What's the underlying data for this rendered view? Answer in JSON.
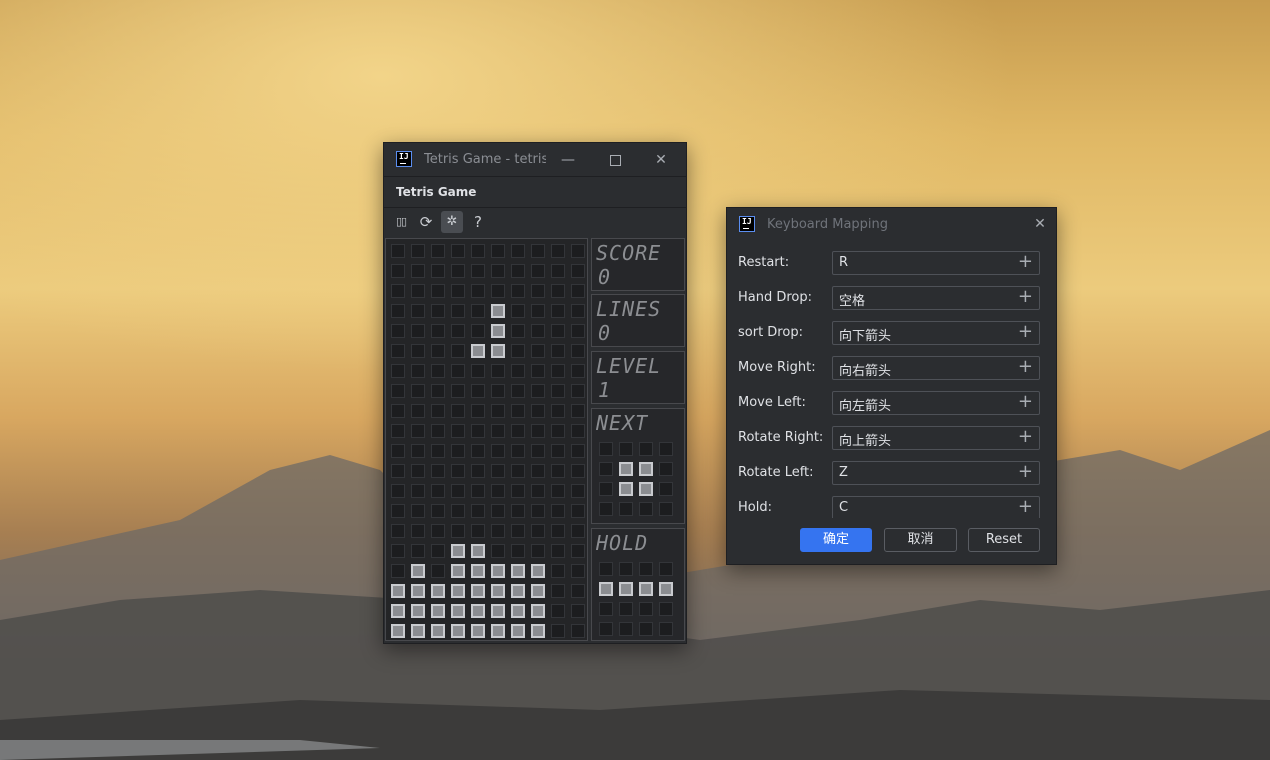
{
  "tetris_window": {
    "title": "Tetris Game - tetris",
    "subtitle": "Tetris Game",
    "toolbar": {
      "pause": "▯▯",
      "restart": "⟳",
      "settings": "✲",
      "help": "?"
    },
    "board": {
      "rows": 20,
      "cols": 10,
      "filled": [
        [
          3,
          5
        ],
        [
          4,
          5
        ],
        [
          5,
          4
        ],
        [
          5,
          5
        ],
        [
          15,
          3
        ],
        [
          15,
          4
        ],
        [
          16,
          1
        ],
        [
          16,
          3
        ],
        [
          16,
          4
        ],
        [
          16,
          5
        ],
        [
          16,
          6
        ],
        [
          16,
          7
        ],
        [
          17,
          0
        ],
        [
          17,
          1
        ],
        [
          17,
          2
        ],
        [
          17,
          3
        ],
        [
          17,
          4
        ],
        [
          17,
          5
        ],
        [
          17,
          6
        ],
        [
          17,
          7
        ],
        [
          18,
          0
        ],
        [
          18,
          1
        ],
        [
          18,
          2
        ],
        [
          18,
          3
        ],
        [
          18,
          4
        ],
        [
          18,
          5
        ],
        [
          18,
          6
        ],
        [
          18,
          7
        ],
        [
          19,
          0
        ],
        [
          19,
          1
        ],
        [
          19,
          2
        ],
        [
          19,
          3
        ],
        [
          19,
          4
        ],
        [
          19,
          5
        ],
        [
          19,
          6
        ],
        [
          19,
          7
        ]
      ]
    },
    "score": {
      "label": "SCORE",
      "value": "0"
    },
    "lines": {
      "label": "LINES",
      "value": "0"
    },
    "level": {
      "label": "LEVEL",
      "value": "1"
    },
    "next": {
      "label": "NEXT",
      "filled": [
        [
          1,
          1
        ],
        [
          1,
          2
        ],
        [
          2,
          1
        ],
        [
          2,
          2
        ]
      ]
    },
    "hold": {
      "label": "HOLD",
      "filled": [
        [
          1,
          0
        ],
        [
          1,
          1
        ],
        [
          1,
          2
        ],
        [
          1,
          3
        ]
      ]
    }
  },
  "dialog": {
    "title": "Keyboard Mapping",
    "rows": [
      {
        "label": "Restart:",
        "value": "R"
      },
      {
        "label": "Hand Drop:",
        "value": "空格"
      },
      {
        "label": "sort Drop:",
        "value": "向下箭头"
      },
      {
        "label": "Move Right:",
        "value": "向右箭头"
      },
      {
        "label": "Move Left:",
        "value": "向左箭头"
      },
      {
        "label": "Rotate Right:",
        "value": "向上箭头"
      },
      {
        "label": "Rotate Left:",
        "value": "Z"
      },
      {
        "label": "Hold:",
        "value": "C"
      }
    ],
    "ok": "确定",
    "cancel": "取消",
    "reset": "Reset"
  }
}
